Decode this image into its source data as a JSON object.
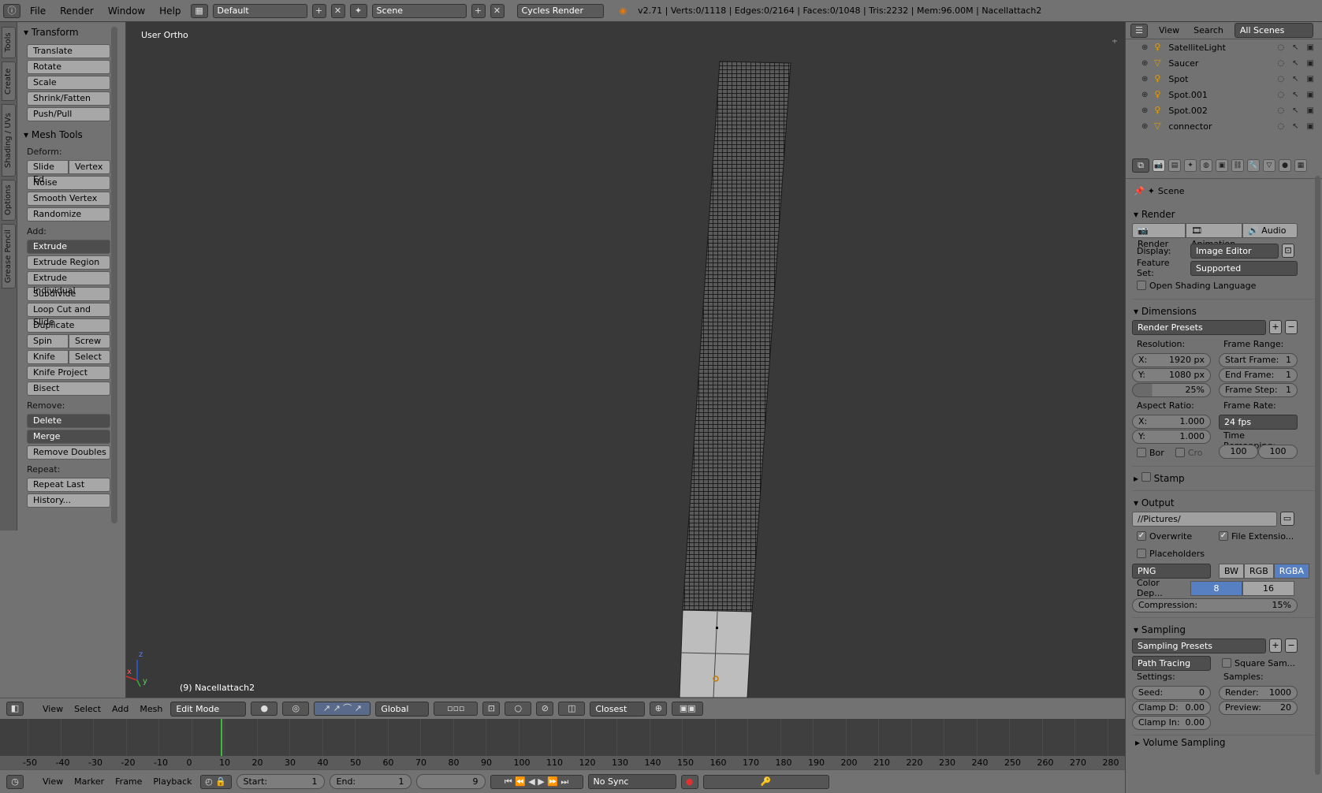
{
  "topbar": {
    "menus": [
      "File",
      "Render",
      "Window",
      "Help"
    ],
    "screen_layout": "Default",
    "scene": "Scene",
    "render_engine": "Cycles Render",
    "stats": "v2.71 | Verts:0/1118 | Edges:0/2164 | Faces:0/1048 | Tris:2232 | Mem:96.00M | Nacellattach2"
  },
  "tool_tabs": [
    "Tools",
    "Create",
    "Shading / UVs",
    "Options",
    "Grease Pencil"
  ],
  "toolshelf": {
    "transform_title": "Transform",
    "transform": [
      "Translate",
      "Rotate",
      "Scale",
      "Shrink/Fatten",
      "Push/Pull"
    ],
    "mesh_tools_title": "Mesh Tools",
    "deform_label": "Deform:",
    "deform_pair": [
      "Slide Ed",
      "Vertex"
    ],
    "deform": [
      "Noise",
      "Smooth Vertex",
      "Randomize"
    ],
    "add_label": "Add:",
    "extrude": "Extrude",
    "add": [
      "Extrude Region",
      "Extrude Individual",
      "Subdivide",
      "Loop Cut and Slide",
      "Duplicate"
    ],
    "add_pair1": [
      "Spin",
      "Screw"
    ],
    "add_pair2": [
      "Knife",
      "Select"
    ],
    "add2": [
      "Knife Project",
      "Bisect"
    ],
    "remove_label": "Remove:",
    "delete": "Delete",
    "merge": "Merge",
    "remove_doubles": "Remove Doubles",
    "repeat_label": "Repeat:",
    "repeat": [
      "Repeat Last",
      "History..."
    ]
  },
  "viewport": {
    "view_label": "User Ortho",
    "object_label": "(9) Nacellattach2",
    "axis_x": "x",
    "axis_y": "y",
    "axis_z": "z"
  },
  "view3d_header": {
    "menus": [
      "View",
      "Select",
      "Add",
      "Mesh"
    ],
    "mode": "Edit Mode",
    "orientation": "Global",
    "snap": "Closest"
  },
  "timeline": {
    "ticks": [
      "-50",
      "-40",
      "-30",
      "-20",
      "-10",
      "0",
      "10",
      "20",
      "30",
      "40",
      "50",
      "60",
      "70",
      "80",
      "90",
      "100",
      "110",
      "120",
      "130",
      "140",
      "150",
      "160",
      "170",
      "180",
      "190",
      "200",
      "210",
      "220",
      "230",
      "240",
      "250",
      "260",
      "270",
      "280"
    ],
    "current_frame": 9,
    "menus": [
      "View",
      "Marker",
      "Frame",
      "Playback"
    ],
    "start_label": "Start:",
    "start": "1",
    "end_label": "End:",
    "end": "1",
    "frame": "9",
    "sync": "No Sync"
  },
  "outliner": {
    "view": "View",
    "search": "Search",
    "scenes": "All Scenes",
    "items": [
      {
        "name": "SatelliteLight",
        "icon": "lamp-icon"
      },
      {
        "name": "Saucer",
        "icon": "mesh-icon"
      },
      {
        "name": "Spot",
        "icon": "lamp-icon"
      },
      {
        "name": "Spot.001",
        "icon": "lamp-icon"
      },
      {
        "name": "Spot.002",
        "icon": "lamp-icon"
      },
      {
        "name": "connector",
        "icon": "mesh-icon"
      }
    ]
  },
  "properties": {
    "context": "Scene",
    "render": {
      "title": "Render",
      "buttons": [
        "Render",
        "Animation",
        "Audio"
      ],
      "display_label": "Display:",
      "display": "Image Editor",
      "feature_set_label": "Feature Set:",
      "feature_set": "Supported",
      "osl": "Open Shading Language"
    },
    "dimensions": {
      "title": "Dimensions",
      "presets": "Render Presets",
      "resolution_label": "Resolution:",
      "res_x_label": "X:",
      "res_x": "1920 px",
      "res_y_label": "Y:",
      "res_y": "1080 px",
      "res_pct": "25%",
      "frame_range_label": "Frame Range:",
      "start_frame_label": "Start Frame:",
      "start_frame": "1",
      "end_frame_label": "End Frame:",
      "end_frame": "1",
      "frame_step_label": "Frame Step:",
      "frame_step": "1",
      "aspect_label": "Aspect Ratio:",
      "asp_x_label": "X:",
      "asp_x": "1.000",
      "asp_y_label": "Y:",
      "asp_y": "1.000",
      "frame_rate_label": "Frame Rate:",
      "frame_rate": "24 fps",
      "time_remap_label": "Time Remapping:",
      "remap_old": "100",
      "remap_new": "100",
      "border": "Bor",
      "crop": "Cro"
    },
    "stamp": {
      "title": "Stamp"
    },
    "output": {
      "title": "Output",
      "path": "//Pictures/",
      "overwrite": "Overwrite",
      "file_ext": "File Extensio...",
      "placeholders": "Placeholders",
      "format": "PNG",
      "color_modes": [
        "BW",
        "RGB",
        "RGBA"
      ],
      "color_depth_label": "Color Dep...",
      "depths": [
        "8",
        "16"
      ],
      "compression_label": "Compression:",
      "compression": "15%"
    },
    "sampling": {
      "title": "Sampling",
      "presets": "Sampling Presets",
      "integrator": "Path Tracing",
      "square": "Square Sam...",
      "settings_label": "Settings:",
      "seed_label": "Seed:",
      "seed": "0",
      "clamp_d_label": "Clamp D:",
      "clamp_d": "0.00",
      "clamp_i_label": "Clamp In:",
      "clamp_i": "0.00",
      "samples_label": "Samples:",
      "render_label": "Render:",
      "render": "1000",
      "preview_label": "Preview:",
      "preview": "20"
    },
    "volume_title": "Volume Sampling"
  },
  "colors": {
    "accent": "#5680c2",
    "frame_cursor": "#3bba3b",
    "viewport_bg": "#393939"
  }
}
